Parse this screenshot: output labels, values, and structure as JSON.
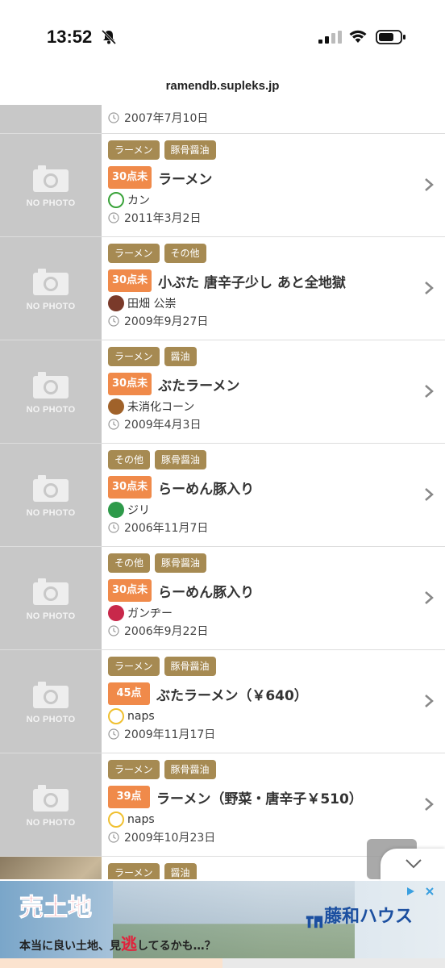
{
  "status_bar": {
    "time": "13:52",
    "icons": [
      "bell-slash-icon",
      "signal-icon",
      "wifi-icon",
      "battery-icon"
    ]
  },
  "browser": {
    "url": "ramendb.supleks.jp"
  },
  "thumb_placeholder": "NO PHOTO",
  "colors": {
    "tag": "#a68a52",
    "score_low": "#f08a4a",
    "thumb": "#c8c8c8"
  },
  "partial_row": {
    "date": "2007年7月10日"
  },
  "reviews": [
    {
      "tags": [
        "ラーメン",
        "豚骨醤油"
      ],
      "score": "30点未",
      "title": "ラーメン",
      "user": "カン",
      "avatar_color": "#3aa33a",
      "date": "2011年3月2日"
    },
    {
      "tags": [
        "ラーメン",
        "その他"
      ],
      "score": "30点未",
      "title": "小ぶた 唐辛子少し あと全地獄",
      "user": "田畑 公崇",
      "avatar_color": "#7a3a2a",
      "date": "2009年9月27日"
    },
    {
      "tags": [
        "ラーメン",
        "醤油"
      ],
      "score": "30点未",
      "title": "ぶたラーメン",
      "user": "未消化コーン",
      "avatar_color": "#a0622a",
      "date": "2009年4月3日"
    },
    {
      "tags": [
        "その他",
        "豚骨醤油"
      ],
      "score": "30点未",
      "title": "らーめん豚入り",
      "user": "ジリ",
      "avatar_color": "#2e9a4a",
      "date": "2006年11月7日"
    },
    {
      "tags": [
        "その他",
        "豚骨醤油"
      ],
      "score": "30点未",
      "title": "らーめん豚入り",
      "user": "ガンヂー",
      "avatar_color": "#c8284a",
      "date": "2006年9月22日"
    },
    {
      "tags": [
        "ラーメン",
        "豚骨醤油"
      ],
      "score": "45点",
      "title": "ぶたラーメン（￥640）",
      "user": "naps",
      "avatar_color": "#f0c030",
      "date": "2009年11月17日"
    },
    {
      "tags": [
        "ラーメン",
        "豚骨醤油"
      ],
      "score": "39点",
      "title": "ラーメン（野菜・唐辛子￥510）",
      "user": "naps",
      "avatar_color": "#f0c030",
      "date": "2009年10月23日"
    },
    {
      "tags": [
        "ラーメン",
        "醤油"
      ],
      "score": "",
      "title": "",
      "user": "",
      "avatar_color": "",
      "date": ""
    }
  ],
  "ad": {
    "headline": "売土地",
    "sub_before": "本当に良い土地、見",
    "sub_emphasis": "逃",
    "sub_after": "してるかも…？",
    "brand": "藤和ハウス"
  }
}
